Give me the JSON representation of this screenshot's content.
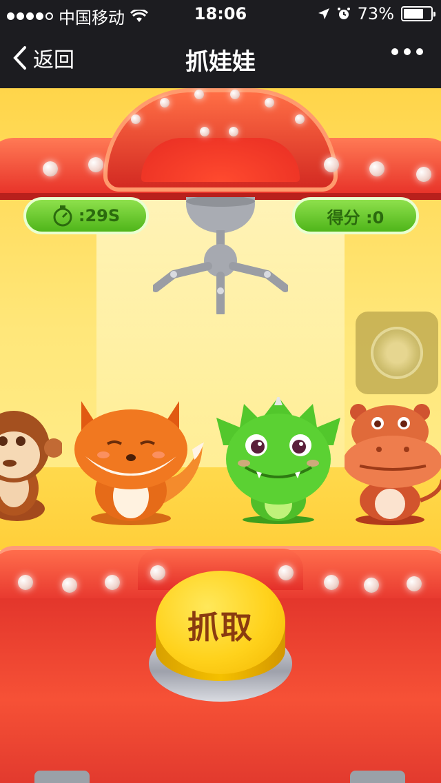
{
  "status_bar": {
    "carrier": "中国移动",
    "time": "18:06",
    "battery_percent": "73%",
    "battery_level": 0.73,
    "signal_dots_filled": 4,
    "icons": [
      "signal-icon",
      "wifi-icon",
      "location-arrow-icon",
      "alarm-icon",
      "battery-icon"
    ]
  },
  "nav": {
    "back_label": "返回",
    "title": "抓娃娃",
    "more_icon": "more-dots-icon"
  },
  "game": {
    "timer": {
      "icon": "stopwatch-icon",
      "text": ":29S"
    },
    "score": {
      "text": "得分 :0"
    },
    "grab_button_label": "抓取",
    "toys": [
      "monkey",
      "fox",
      "dragon",
      "hippo"
    ]
  },
  "colors": {
    "frame_red": "#e8342a",
    "background_yellow": "#ffe77a",
    "pill_green": "#4fb51a",
    "button_yellow": "#ffd21c"
  }
}
